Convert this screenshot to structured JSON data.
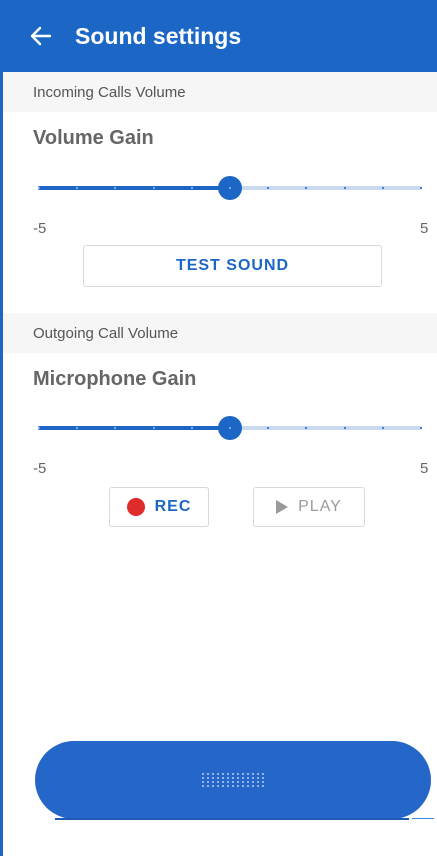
{
  "header": {
    "title": "Sound settings",
    "back_icon": "arrow-left-icon"
  },
  "incoming": {
    "section_label": "Incoming Calls Volume",
    "gain_title": "Volume Gain",
    "slider": {
      "min": -5,
      "max": 5,
      "value": 0,
      "min_label": "-5",
      "max_label": "5"
    },
    "test_button_label": "TEST SOUND"
  },
  "outgoing": {
    "section_label": "Outgoing Call Volume",
    "gain_title": "Microphone Gain",
    "slider": {
      "min": -5,
      "max": 5,
      "value": 0,
      "min_label": "-5",
      "max_label": "5"
    },
    "rec_button_label": "REC",
    "play_button_label": "PLAY"
  },
  "colors": {
    "primary": "#1c67c6",
    "record": "#e02b2b",
    "disabled": "#9a9a9a"
  }
}
